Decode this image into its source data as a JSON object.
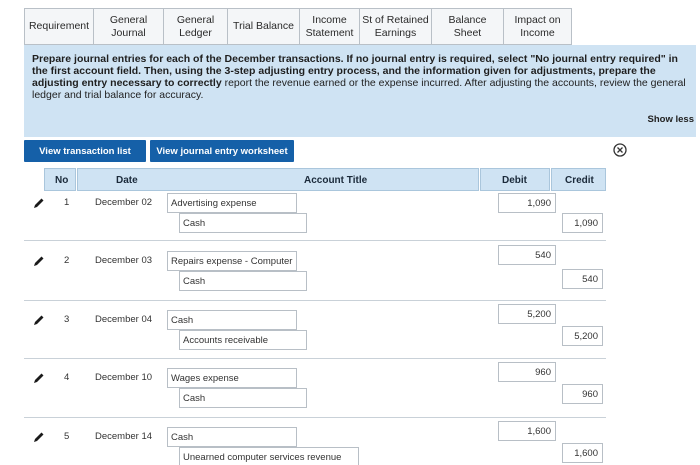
{
  "tabs": [
    {
      "l1": "Requirement",
      "l2": ""
    },
    {
      "l1": "General",
      "l2": "Journal"
    },
    {
      "l1": "General",
      "l2": "Ledger"
    },
    {
      "l1": "Trial Balance",
      "l2": ""
    },
    {
      "l1": "Income",
      "l2": "Statement"
    },
    {
      "l1": "St of Retained",
      "l2": "Earnings"
    },
    {
      "l1": "Balance Sheet",
      "l2": ""
    },
    {
      "l1": "Impact on",
      "l2": "Income"
    }
  ],
  "instructions": {
    "b1": "Prepare journal entries for each of the December transactions. If no journal entry is required, select \"No journal entry required\" in the first account field. Then, using the 3-step adjusting entry process, and the information given for adjustments, prepare the adjusting entry necessary to correctly",
    "n1": " report the revenue earned or the expense incurred. After adjusting the accounts, review the general ledger and trial balance for accuracy."
  },
  "show_less": "Show less",
  "buttons": {
    "view_transactions": "View transaction list",
    "view_worksheet": "View journal entry worksheet"
  },
  "table": {
    "headers": {
      "no": "No",
      "date": "Date",
      "account": "Account Title",
      "debit": "Debit",
      "credit": "Credit"
    },
    "rows": [
      {
        "no": "1",
        "date": "December 02",
        "debit_account": "Advertising expense",
        "credit_account": "Cash",
        "debit": "1,090",
        "credit": "1,090"
      },
      {
        "no": "2",
        "date": "December 03",
        "debit_account": "Repairs expense - Computer",
        "credit_account": "Cash",
        "debit": "540",
        "credit": "540"
      },
      {
        "no": "3",
        "date": "December 04",
        "debit_account": "Cash",
        "credit_account": "Accounts receivable",
        "debit": "5,200",
        "credit": "5,200"
      },
      {
        "no": "4",
        "date": "December 10",
        "debit_account": "Wages expense",
        "credit_account": "Cash",
        "debit": "960",
        "credit": "960"
      },
      {
        "no": "5",
        "date": "December 14",
        "debit_account": "Cash",
        "credit_account": "Unearned computer services revenue",
        "debit": "1,600",
        "credit": "1,600"
      }
    ]
  },
  "colors": {
    "accent": "#1560a8",
    "panel": "#cfe3f3"
  }
}
